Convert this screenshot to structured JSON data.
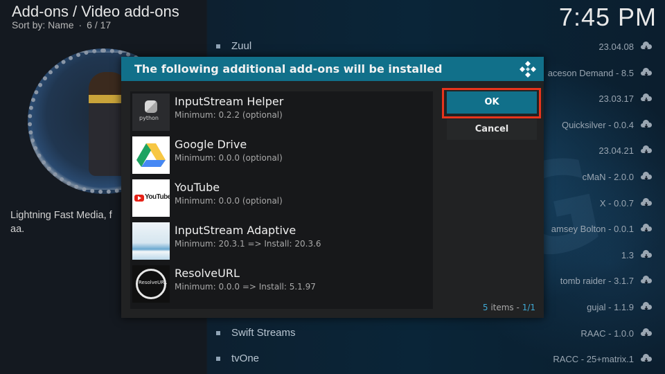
{
  "header": {
    "breadcrumb": "Add-ons / Video add-ons",
    "sort_label": "Sort by: Name",
    "position": "6 / 17",
    "clock": "7:45 PM"
  },
  "addon_info": {
    "description": "Lightning Fast Media, f\naa."
  },
  "background_list": [
    {
      "name": "Zuul",
      "version": "23.04.08"
    },
    {
      "name": "",
      "version": "aceson Demand - 8.5"
    },
    {
      "name": "",
      "version": "23.03.17"
    },
    {
      "name": "",
      "version": "Quicksilver - 0.0.4"
    },
    {
      "name": "",
      "version": "23.04.21"
    },
    {
      "name": "",
      "version": "cMaN - 2.0.0"
    },
    {
      "name": "",
      "version": "X - 0.0.7"
    },
    {
      "name": "",
      "version": "amsey Bolton - 0.0.1"
    },
    {
      "name": "",
      "version": "1.3"
    },
    {
      "name": "",
      "version": "tomb raider - 3.1.7"
    },
    {
      "name": "",
      "version": "gujal - 1.1.9"
    },
    {
      "name": "Swift Streams",
      "version": "RAAC - 1.0.0"
    },
    {
      "name": "tvOne",
      "version": "RACC - 25+matrix.1"
    }
  ],
  "dialog": {
    "title": "The following additional add-ons will be installed",
    "ok_label": "OK",
    "cancel_label": "Cancel",
    "count_num": "5",
    "count_label": "items",
    "count_sep": "-",
    "count_page": "1/1",
    "addons": [
      {
        "name": "InputStream Helper",
        "detail": "Minimum: 0.2.2 (optional)",
        "icon": "python-icon"
      },
      {
        "name": "Google Drive",
        "detail": "Minimum: 0.0.0 (optional)",
        "icon": "google-drive-icon"
      },
      {
        "name": "YouTube",
        "detail": "Minimum: 0.0.0 (optional)",
        "icon": "youtube-icon"
      },
      {
        "name": "InputStream Adaptive",
        "detail": "Minimum: 20.3.1 => Install: 20.3.6",
        "icon": "inputstream-adaptive-icon"
      },
      {
        "name": "ResolveURL",
        "detail": "Minimum: 0.0.0 => Install: 5.1.97",
        "icon": "resolveurl-icon"
      }
    ],
    "thumb_text": {
      "python": "python",
      "youtube": "YouTube",
      "resolve": "ResolveURL"
    }
  },
  "colors": {
    "accent": "#11708a",
    "highlight": "#e8341c",
    "count_accent": "#3fa9d4"
  }
}
